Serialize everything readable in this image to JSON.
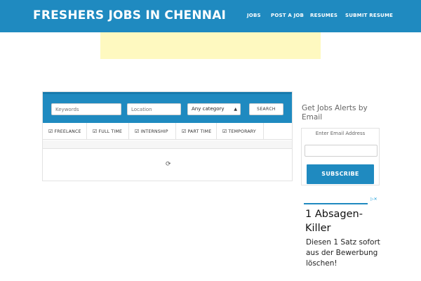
{
  "header": {
    "site_title": "FRESHERS JOBS IN CHENNAI",
    "nav": [
      "JOBS",
      "POST A JOB",
      "RESUMES",
      "SUBMIT RESUME"
    ],
    "background": "#1f8ac0"
  },
  "search": {
    "keywords_placeholder": "Keywords",
    "location_placeholder": "Location",
    "category_selected": "Any category",
    "search_label": "SEARCH"
  },
  "filters": [
    "FREELANCE",
    "FULL TIME",
    "INTERNSHIP",
    "PART TIME",
    "TEMPORARY"
  ],
  "sidebar": {
    "alerts_title": "Get Jobs Alerts by Email",
    "email_placeholder": "Enter Email Address",
    "subscribe_label": "SUBSCRIBE"
  },
  "ad": {
    "headline": "1 Absagen-Killer",
    "body": "Diesen 1 Satz sofort aus der Bewerbung löschen!"
  },
  "icons": {
    "checkbox": "checked-checkbox-icon",
    "spinner": "loading-spinner-icon",
    "ad_choices": "ad-choices-icon"
  },
  "colors": {
    "primary": "#1f8ac0",
    "ad_banner": "#fef9c0"
  }
}
